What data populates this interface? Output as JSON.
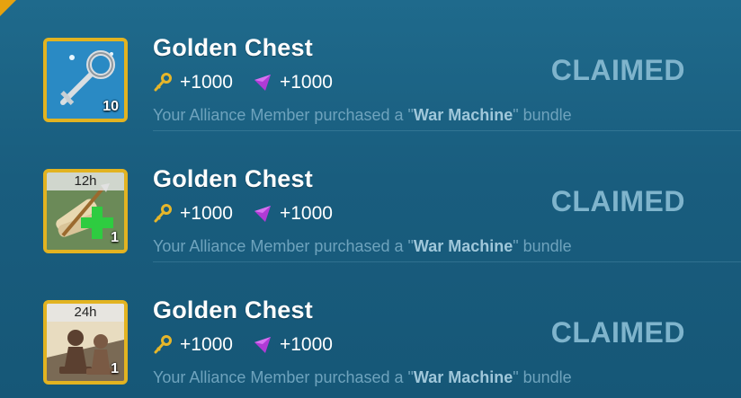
{
  "items": [
    {
      "icon": "silver-key-icon",
      "count": "10",
      "timer": "",
      "title": "Golden Chest",
      "reward1": "+1000",
      "reward2": "+1000",
      "desc_prefix": "Your Alliance Member purchased a \"",
      "desc_bold": "War Machine",
      "desc_suffix": "\" bundle",
      "status": "CLAIMED"
    },
    {
      "icon": "speedup-scroll-icon",
      "count": "1",
      "timer": "12h",
      "title": "Golden Chest",
      "reward1": "+1000",
      "reward2": "+1000",
      "desc_prefix": "Your Alliance Member purchased a \"",
      "desc_bold": "War Machine",
      "desc_suffix": "\" bundle",
      "status": "CLAIMED"
    },
    {
      "icon": "chess-pawn-icon",
      "count": "1",
      "timer": "24h",
      "title": "Golden Chest",
      "reward1": "+1000",
      "reward2": "+1000",
      "desc_prefix": "Your Alliance Member purchased a \"",
      "desc_bold": "War Machine",
      "desc_suffix": "\" bundle",
      "status": "CLAIMED"
    }
  ],
  "colors": {
    "frame": "#e2b321",
    "status": "#7fb4cc",
    "gem": "#b03ad6",
    "key": "#e6b62a"
  }
}
